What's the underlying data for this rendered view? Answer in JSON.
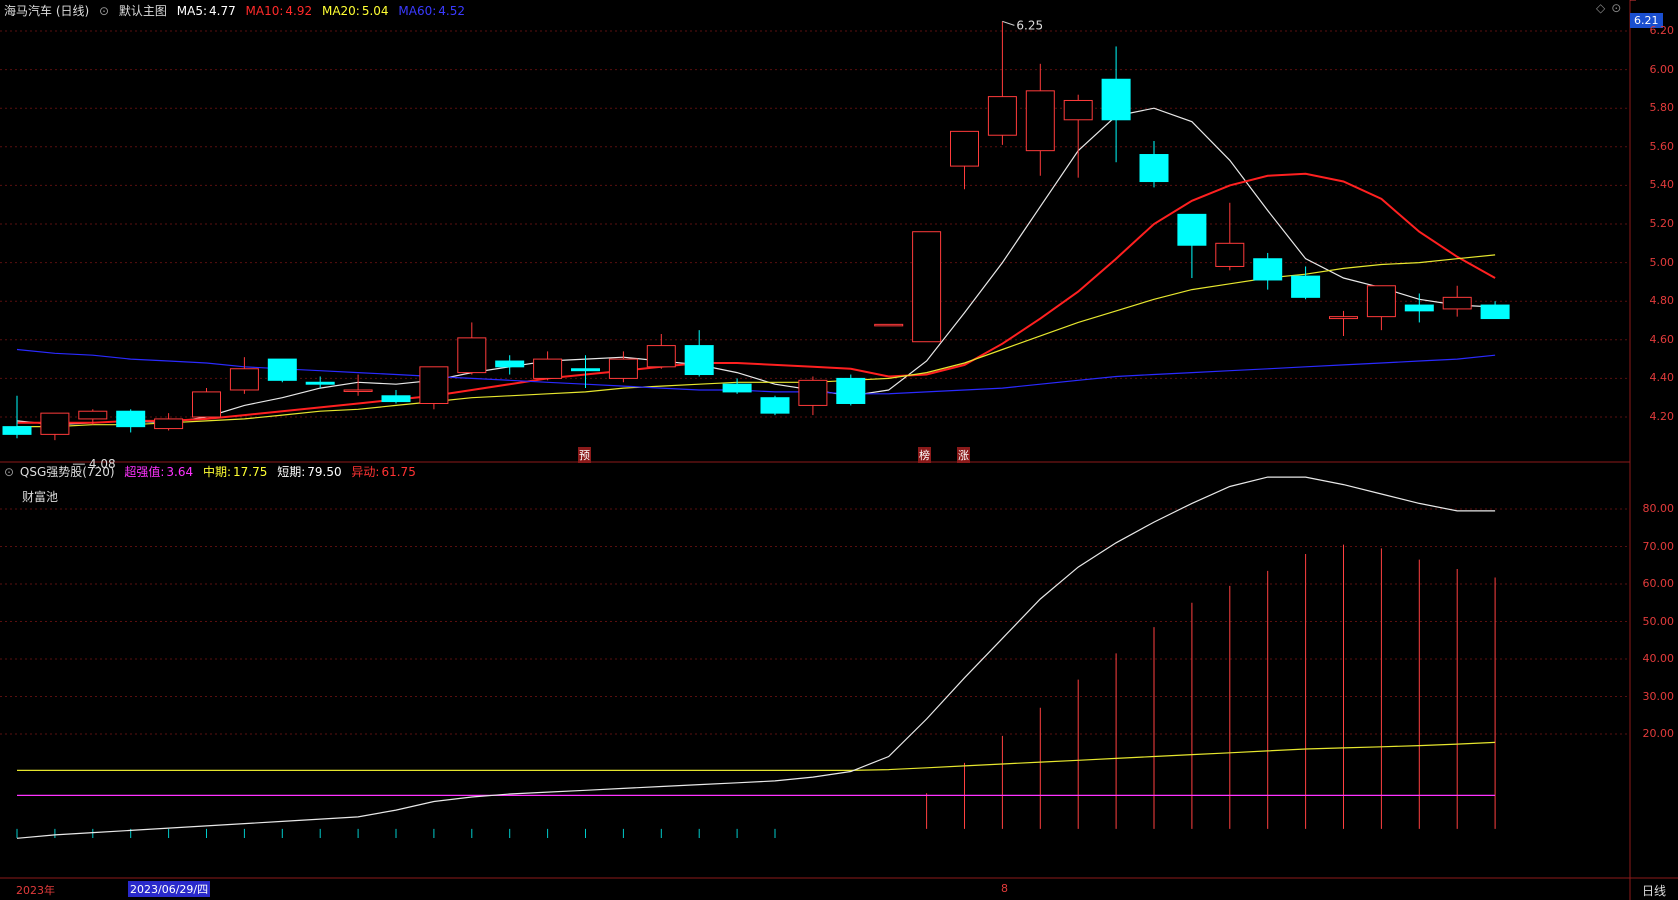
{
  "main_header": {
    "stock_name": "海马汽车 (日线)",
    "chart_menu": "默认主图",
    "ma": [
      {
        "label": "MA5:",
        "value": "4.77",
        "color": "#ffffff"
      },
      {
        "label": "MA10:",
        "value": "4.92",
        "color": "#ff2a2a"
      },
      {
        "label": "MA20:",
        "value": "5.04",
        "color": "#ffff33"
      },
      {
        "label": "MA60:",
        "value": "4.52",
        "color": "#2a2aff"
      }
    ]
  },
  "sub_header": {
    "indicator": "QSG强势股(720)",
    "items": [
      {
        "label": "超强值:",
        "value": "3.64",
        "color": "#ff33ff"
      },
      {
        "label": "中期:",
        "value": "17.75",
        "color": "#ffff33"
      },
      {
        "label": "短期:",
        "value": "79.50",
        "color": "#ffffff"
      },
      {
        "label": "异动:",
        "value": "61.75",
        "color": "#ff3333"
      }
    ],
    "pool_label": "财富池"
  },
  "price_axis": {
    "ticks": [
      "6.20",
      "6.00",
      "5.80",
      "5.60",
      "5.40",
      "5.20",
      "5.00",
      "4.80",
      "4.60",
      "4.40",
      "4.20"
    ],
    "current_price": "6.21"
  },
  "sub_axis": {
    "ticks": [
      "80.00",
      "70.00",
      "60.00",
      "50.00",
      "40.00",
      "30.00",
      "20.00"
    ]
  },
  "annotations": {
    "high_label": "6.25",
    "low_label": "4.08",
    "markers": [
      "预",
      "榜",
      "涨"
    ]
  },
  "time_axis": {
    "year_label": "2023年",
    "selected_date": "2023/06/29/四",
    "month_label": "8",
    "period_button": "日线"
  },
  "chart_data": [
    {
      "type": "candlestick",
      "title": "海马汽车 (日线)",
      "ylim": [
        4.05,
        6.29
      ],
      "candles": [
        {
          "o": 4.15,
          "h": 4.31,
          "l": 4.09,
          "c": 4.11
        },
        {
          "o": 4.11,
          "h": 4.21,
          "l": 4.08,
          "c": 4.22
        },
        {
          "o": 4.19,
          "h": 4.24,
          "l": 4.16,
          "c": 4.23
        },
        {
          "o": 4.23,
          "h": 4.24,
          "l": 4.12,
          "c": 4.15
        },
        {
          "o": 4.14,
          "h": 4.22,
          "l": 4.13,
          "c": 4.19
        },
        {
          "o": 4.2,
          "h": 4.35,
          "l": 4.2,
          "c": 4.33
        },
        {
          "o": 4.34,
          "h": 4.51,
          "l": 4.32,
          "c": 4.45
        },
        {
          "o": 4.5,
          "h": 4.5,
          "l": 4.38,
          "c": 4.39
        },
        {
          "o": 4.38,
          "h": 4.41,
          "l": 4.35,
          "c": 4.37
        },
        {
          "o": 4.34,
          "h": 4.42,
          "l": 4.31,
          "c": 4.34
        },
        {
          "o": 4.31,
          "h": 4.34,
          "l": 4.27,
          "c": 4.28
        },
        {
          "o": 4.27,
          "h": 4.46,
          "l": 4.24,
          "c": 4.46
        },
        {
          "o": 4.43,
          "h": 4.69,
          "l": 4.42,
          "c": 4.61
        },
        {
          "o": 4.49,
          "h": 4.52,
          "l": 4.42,
          "c": 4.46
        },
        {
          "o": 4.4,
          "h": 4.54,
          "l": 4.39,
          "c": 4.5
        },
        {
          "o": 4.45,
          "h": 4.52,
          "l": 4.35,
          "c": 4.44
        },
        {
          "o": 4.4,
          "h": 4.54,
          "l": 4.38,
          "c": 4.5
        },
        {
          "o": 4.46,
          "h": 4.63,
          "l": 4.45,
          "c": 4.57
        },
        {
          "o": 4.57,
          "h": 4.65,
          "l": 4.41,
          "c": 4.42
        },
        {
          "o": 4.37,
          "h": 4.4,
          "l": 4.32,
          "c": 4.33
        },
        {
          "o": 4.3,
          "h": 4.31,
          "l": 4.21,
          "c": 4.22
        },
        {
          "o": 4.26,
          "h": 4.41,
          "l": 4.21,
          "c": 4.39
        },
        {
          "o": 4.4,
          "h": 4.42,
          "l": 4.26,
          "c": 4.27
        },
        {
          "o": 4.68,
          "h": 4.68,
          "l": 4.68,
          "c": 4.68
        },
        {
          "o": 4.59,
          "h": 5.16,
          "l": 4.59,
          "c": 5.16
        },
        {
          "o": 5.5,
          "h": 5.68,
          "l": 5.38,
          "c": 5.68
        },
        {
          "o": 5.66,
          "h": 6.25,
          "l": 5.61,
          "c": 5.86
        },
        {
          "o": 5.58,
          "h": 6.03,
          "l": 5.45,
          "c": 5.89
        },
        {
          "o": 5.74,
          "h": 5.87,
          "l": 5.44,
          "c": 5.84
        },
        {
          "o": 5.95,
          "h": 6.12,
          "l": 5.52,
          "c": 5.74
        },
        {
          "o": 5.56,
          "h": 5.63,
          "l": 5.39,
          "c": 5.42
        },
        {
          "o": 5.25,
          "h": 5.25,
          "l": 4.92,
          "c": 5.09
        },
        {
          "o": 4.98,
          "h": 5.31,
          "l": 4.96,
          "c": 5.1
        },
        {
          "o": 5.02,
          "h": 5.05,
          "l": 4.86,
          "c": 4.91
        },
        {
          "o": 4.93,
          "h": 4.98,
          "l": 4.81,
          "c": 4.82
        },
        {
          "o": 4.71,
          "h": 4.75,
          "l": 4.62,
          "c": 4.72
        },
        {
          "o": 4.72,
          "h": 4.88,
          "l": 4.65,
          "c": 4.88
        },
        {
          "o": 4.78,
          "h": 4.84,
          "l": 4.69,
          "c": 4.75
        },
        {
          "o": 4.76,
          "h": 4.88,
          "l": 4.72,
          "c": 4.82
        },
        {
          "o": 4.78,
          "h": 4.8,
          "l": 4.72,
          "c": 4.71
        }
      ],
      "series": [
        {
          "name": "MA5",
          "values": [
            4.18,
            4.16,
            4.17,
            4.18,
            4.17,
            4.2,
            4.26,
            4.3,
            4.35,
            4.38,
            4.37,
            4.39,
            4.43,
            4.46,
            4.49,
            4.5,
            4.51,
            4.49,
            4.47,
            4.43,
            4.37,
            4.34,
            4.31,
            4.34,
            4.49,
            4.74,
            5.0,
            5.29,
            5.58,
            5.76,
            5.8,
            5.73,
            5.53,
            5.27,
            5.02,
            4.92,
            4.87,
            4.81,
            4.78,
            4.77
          ]
        },
        {
          "name": "MA10",
          "values": [
            4.17,
            4.17,
            4.17,
            4.18,
            4.18,
            4.19,
            4.21,
            4.23,
            4.25,
            4.27,
            4.29,
            4.31,
            4.34,
            4.37,
            4.4,
            4.42,
            4.44,
            4.46,
            4.48,
            4.48,
            4.47,
            4.46,
            4.45,
            4.41,
            4.42,
            4.47,
            4.58,
            4.71,
            4.85,
            5.02,
            5.2,
            5.32,
            5.4,
            5.45,
            5.46,
            5.42,
            5.33,
            5.16,
            5.03,
            4.92
          ]
        },
        {
          "name": "MA20",
          "values": [
            4.15,
            4.15,
            4.16,
            4.16,
            4.17,
            4.18,
            4.19,
            4.21,
            4.23,
            4.24,
            4.26,
            4.28,
            4.3,
            4.31,
            4.32,
            4.33,
            4.35,
            4.36,
            4.37,
            4.38,
            4.38,
            4.38,
            4.39,
            4.4,
            4.43,
            4.48,
            4.55,
            4.62,
            4.69,
            4.75,
            4.81,
            4.86,
            4.89,
            4.92,
            4.94,
            4.97,
            4.99,
            5.0,
            5.02,
            5.04
          ]
        },
        {
          "name": "MA60",
          "values": [
            4.55,
            4.53,
            4.52,
            4.5,
            4.49,
            4.48,
            4.46,
            4.45,
            4.44,
            4.43,
            4.42,
            4.41,
            4.4,
            4.39,
            4.38,
            4.37,
            4.36,
            4.35,
            4.34,
            4.34,
            4.33,
            4.33,
            4.32,
            4.32,
            4.33,
            4.34,
            4.35,
            4.37,
            4.39,
            4.41,
            4.42,
            4.43,
            4.44,
            4.45,
            4.46,
            4.47,
            4.48,
            4.49,
            4.5,
            4.52
          ]
        }
      ]
    },
    {
      "type": "line",
      "title": "QSG强势股(720)",
      "ylim": [
        -14,
        93
      ],
      "series": [
        {
          "name": "超强值",
          "values": [
            3.64,
            3.64,
            3.64,
            3.64,
            3.64,
            3.64,
            3.64,
            3.64,
            3.64,
            3.64,
            3.64,
            3.64,
            3.64,
            3.64,
            3.64,
            3.64,
            3.64,
            3.64,
            3.64,
            3.64,
            3.64,
            3.64,
            3.64,
            3.64,
            3.64,
            3.64,
            3.64,
            3.64,
            3.64,
            3.64,
            3.64,
            3.64,
            3.64,
            3.64,
            3.64,
            3.64,
            3.64,
            3.64,
            3.64,
            3.64
          ]
        },
        {
          "name": "中期",
          "values": [
            10.3,
            10.3,
            10.3,
            10.3,
            10.3,
            10.3,
            10.3,
            10.3,
            10.3,
            10.3,
            10.3,
            10.3,
            10.3,
            10.3,
            10.3,
            10.3,
            10.3,
            10.3,
            10.3,
            10.3,
            10.3,
            10.3,
            10.3,
            10.5,
            11.0,
            11.5,
            12.0,
            12.5,
            13.0,
            13.5,
            14.0,
            14.5,
            15.0,
            15.5,
            16.0,
            16.3,
            16.6,
            16.9,
            17.3,
            17.75
          ]
        },
        {
          "name": "短期",
          "values": [
            -7.8,
            -6.9,
            -6.3,
            -5.7,
            -5.1,
            -4.5,
            -3.9,
            -3.3,
            -2.7,
            -2.1,
            -0.3,
            2.0,
            3.2,
            4.0,
            4.5,
            5.0,
            5.5,
            6.0,
            6.5,
            7.0,
            7.5,
            8.5,
            10.0,
            14.0,
            24.0,
            35.0,
            45.5,
            56.0,
            64.5,
            71.0,
            76.5,
            81.5,
            86.0,
            88.5,
            88.5,
            86.5,
            84.0,
            81.5,
            79.5,
            79.5
          ]
        },
        {
          "name": "异动",
          "values": [
            -5.3,
            -5.3,
            -5.3,
            -5.3,
            -5.3,
            -5.3,
            -5.3,
            -5.3,
            -5.3,
            -5.3,
            -5.3,
            -5.3,
            -5.3,
            -5.3,
            -5.3,
            -5.3,
            -5.3,
            -5.3,
            -5.3,
            -5.3,
            -5.3,
            0,
            0,
            0,
            4.2,
            12.3,
            19.5,
            27.0,
            34.5,
            41.5,
            48.5,
            55.0,
            59.5,
            63.5,
            68.0,
            70.5,
            69.5,
            66.5,
            64.0,
            61.75
          ]
        }
      ]
    }
  ]
}
